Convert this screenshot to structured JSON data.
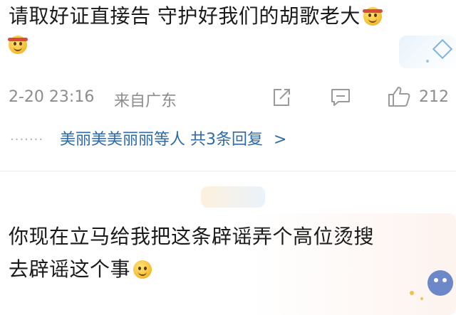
{
  "comment1": {
    "line1": "请取好证直接告 守护好我们的胡歌老大",
    "emoji1": "headband-smile-emoji",
    "emoji2": "headband-smile-emoji",
    "timestamp": "2-20 23:16",
    "source": "来自广东",
    "like_count": "212",
    "replies": {
      "dots": "·······",
      "text": "美丽美美丽丽等人 共3条回复",
      "chevron": ">"
    }
  },
  "comment2": {
    "line1": "你现在立马给我把这条辟谣弄个高位烫搜",
    "line2": "去辟谣这个事",
    "emoji": "smile-emoji"
  },
  "icons": {
    "share": "share-icon",
    "comment": "comment-icon",
    "like": "thumbs-up-icon"
  },
  "colors": {
    "text": "#1a1a1a",
    "meta": "#8d8d8d",
    "link": "#2e6aa8"
  }
}
